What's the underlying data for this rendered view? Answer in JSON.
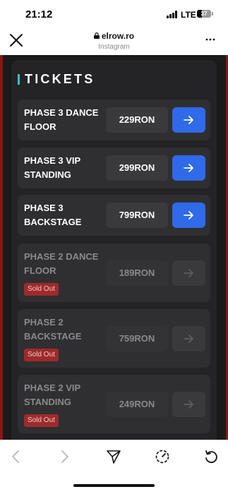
{
  "status_bar": {
    "time": "21:12",
    "network": "LTE",
    "battery_level": "37",
    "battery_fraction": 0.37
  },
  "browser": {
    "url": "elrow.ro",
    "source": "Instagram",
    "close_icon": "close-icon",
    "more_icon": "more-icon"
  },
  "section": {
    "title": "TICKETS",
    "accent_color": "#36c2c4"
  },
  "tickets": [
    {
      "name": "PHASE 3 DANCE FLOOR",
      "price": "229RON",
      "sold_out": false
    },
    {
      "name": "PHASE 3 VIP STANDING",
      "price": "299RON",
      "sold_out": false
    },
    {
      "name": "PHASE 3 BACKSTAGE",
      "price": "799RON",
      "sold_out": false
    },
    {
      "name": "PHASE 2 DANCE FLOOR",
      "price": "189RON",
      "sold_out": true,
      "badge": "Sold Out"
    },
    {
      "name": "PHASE 2 BACKSTAGE",
      "price": "759RON",
      "sold_out": true,
      "badge": "Sold Out"
    },
    {
      "name": "PHASE 2 VIP STANDING",
      "price": "249RON",
      "sold_out": true,
      "badge": "Sold Out"
    }
  ],
  "colors": {
    "buy_button": "#2f6ae8",
    "sold_badge": "#9e2a2b",
    "page_edge": "#8b1515"
  },
  "toolbar": {
    "icons": [
      "back-icon",
      "forward-icon",
      "share-icon",
      "speed-icon",
      "reload-icon"
    ]
  }
}
